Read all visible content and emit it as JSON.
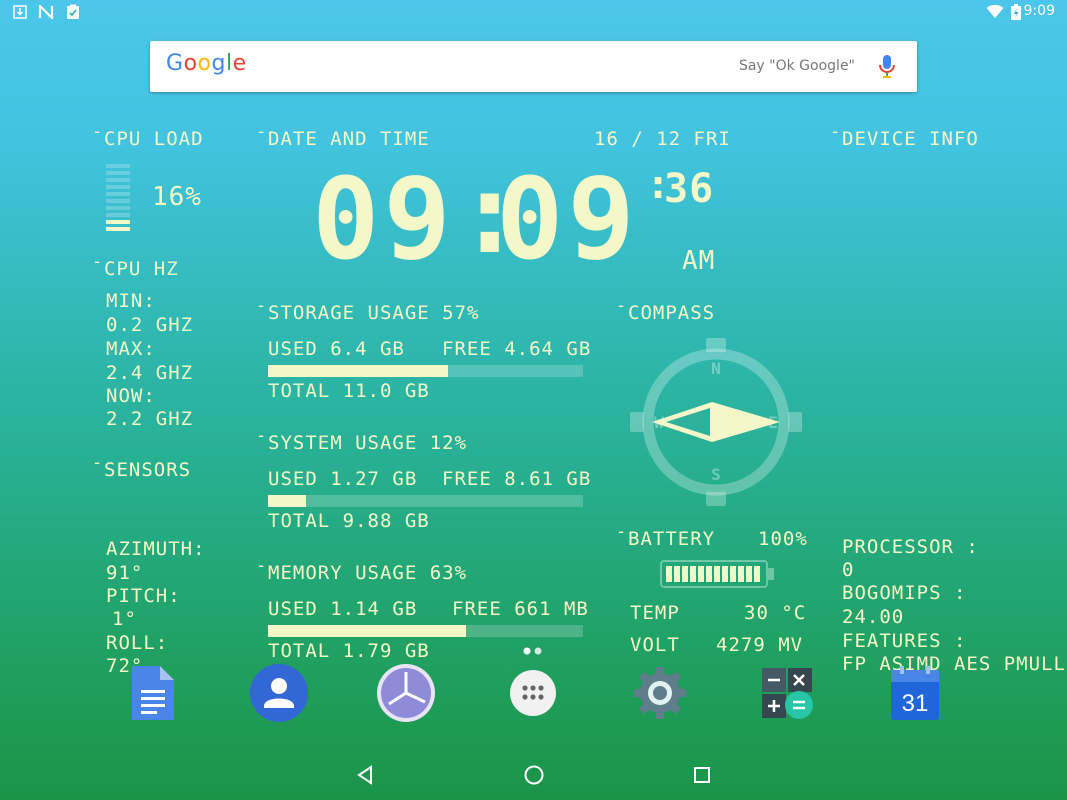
{
  "status_bar": {
    "time": "9:09",
    "left_icons": [
      "download-icon",
      "n-notification-icon",
      "clipboard-icon"
    ],
    "right_icons": [
      "wifi-icon",
      "battery-charging-icon"
    ]
  },
  "search": {
    "logo": "Google",
    "hint": "Say \"Ok Google\""
  },
  "cpu_load": {
    "title": "CPU LOAD",
    "value": "16%",
    "level": 0.16
  },
  "cpu_hz": {
    "title": "CPU HZ",
    "min_label": "MIN:",
    "min_value": "0.2 GHZ",
    "max_label": "MAX:",
    "max_value": "2.4 GHZ",
    "now_label": "NOW:",
    "now_value": "2.2 GHZ"
  },
  "sensors": {
    "title": "SENSORS",
    "azimuth_label": "AZIMUTH:",
    "azimuth_value": "91°",
    "pitch_label": "PITCH:",
    "pitch_value": "1°",
    "roll_label": "ROLL:",
    "roll_value": "72°"
  },
  "datetime": {
    "title": "DATE AND TIME",
    "date": "16 / 12 FRI",
    "hours": "09",
    "minutes": "09",
    "seconds": "36",
    "ampm": "AM"
  },
  "storage": {
    "title": "STORAGE USAGE 57%",
    "used": "USED 6.4 GB",
    "free": "FREE 4.64 GB",
    "total": "TOTAL 11.0 GB",
    "fraction": 0.57
  },
  "system": {
    "title": "SYSTEM USAGE  12%",
    "used": "USED 1.27 GB",
    "free": "FREE 8.61 GB",
    "total": "TOTAL 9.88 GB",
    "fraction": 0.12
  },
  "memory": {
    "title": "MEMORY USAGE 63%",
    "used": "USED 1.14 GB",
    "free": "FREE 661 MB",
    "total": "TOTAL 1.79 GB",
    "fraction": 0.63
  },
  "compass": {
    "title": "COMPASS",
    "n": "N",
    "e": "E",
    "s": "S",
    "w": "W"
  },
  "battery": {
    "title": "BATTERY",
    "percent": "100%",
    "level": 1.0,
    "temp_label": "TEMP",
    "temp_value": "30 °C",
    "volt_label": "VOLT",
    "volt_value": "4279 MV"
  },
  "device_info": {
    "title": "DEVICE INFO",
    "processor_label": "PROCESSOR :",
    "processor_value": "0",
    "bogomips_label": "BOGOMIPS :",
    "bogomips_value": "24.00",
    "features_label": "FEATURES :",
    "features_value": "FP ASIMD AES PMULL"
  },
  "dock": {
    "apps": [
      "docs-icon",
      "contacts-icon",
      "clock-icon",
      "app-drawer-icon",
      "settings-icon",
      "calculator-icon",
      "calendar-icon"
    ],
    "calendar_day": "31"
  },
  "nav": [
    "back-icon",
    "home-icon",
    "recents-icon"
  ],
  "colors": {
    "widget_text": "#f4f7c8",
    "gradient_top": "#4cc6ea",
    "gradient_bottom": "#1b9448"
  }
}
